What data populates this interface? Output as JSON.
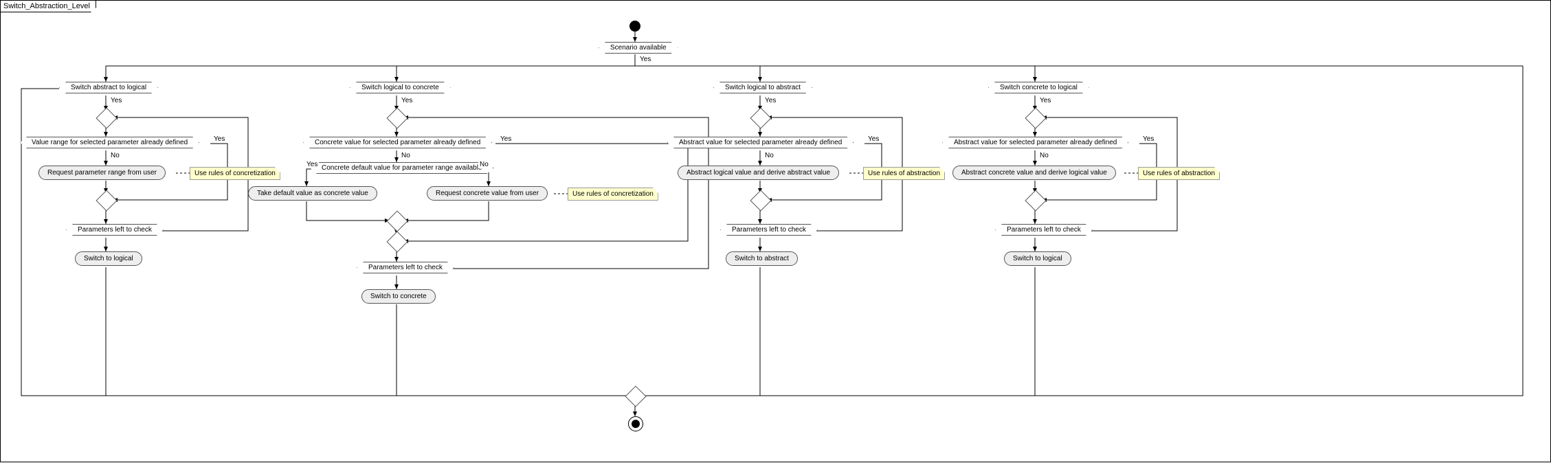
{
  "diagram": {
    "title": "Switch_Abstraction_Level",
    "initial_decision": "Scenario available",
    "labels": {
      "yes": "Yes",
      "no": "No"
    },
    "branches": [
      {
        "id": "b1",
        "decision": "Switch abstract to logical",
        "check_defined": "Value range for selected parameter already defined",
        "action_main": "Request parameter range from user",
        "note": "Use rules of concretization",
        "params_left": "Parameters left to check",
        "switch_action": "Switch to logical"
      },
      {
        "id": "b2",
        "decision": "Switch logical to concrete",
        "check_defined": "Concrete value for selected parameter already defined",
        "check_default": "Concrete default value for parameter range available",
        "action_default": "Take default value as concrete value",
        "action_request": "Request concrete value from user",
        "note": "Use rules of concretization",
        "params_left": "Parameters left to check",
        "switch_action": "Switch to concrete"
      },
      {
        "id": "b3",
        "decision": "Switch logical to abstract",
        "check_defined": "Abstract value for selected parameter already defined",
        "action_main": "Abstract logical value and derive abstract value",
        "note": "Use rules of abstraction",
        "params_left": "Parameters left to check",
        "switch_action": "Switch to abstract"
      },
      {
        "id": "b4",
        "decision": "Switch concrete to logical",
        "check_defined": "Abstract value for selected parameter already defined",
        "action_main": "Abstract concrete value and derive logical value",
        "note": "Use rules of abstraction",
        "params_left": "Parameters left to check",
        "switch_action": "Switch to logical"
      }
    ]
  }
}
